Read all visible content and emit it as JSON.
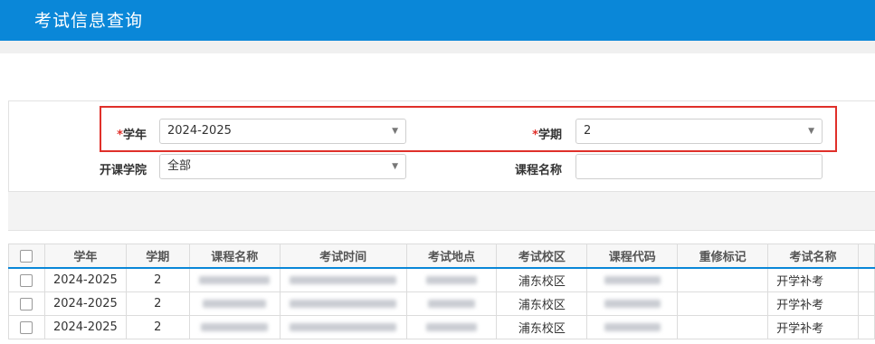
{
  "header": {
    "title": "考试信息查询"
  },
  "form": {
    "year_label": "学年",
    "year_value": "2024-2025",
    "term_label": "学期",
    "term_value": "2",
    "required_mark": "*",
    "college_label": "开课学院",
    "college_value": "全部",
    "course_label": "课程名称",
    "course_value": ""
  },
  "table": {
    "headers": [
      "学年",
      "学期",
      "课程名称",
      "考试时间",
      "考试地点",
      "考试校区",
      "课程代码",
      "重修标记",
      "考试名称"
    ],
    "rows": [
      {
        "year": "2024-2025",
        "term": "2",
        "campus": "浦东校区",
        "exam_name": "开学补考"
      },
      {
        "year": "2024-2025",
        "term": "2",
        "campus": "浦东校区",
        "exam_name": "开学补考"
      },
      {
        "year": "2024-2025",
        "term": "2",
        "campus": "浦东校区",
        "exam_name": "开学补考"
      }
    ]
  }
}
